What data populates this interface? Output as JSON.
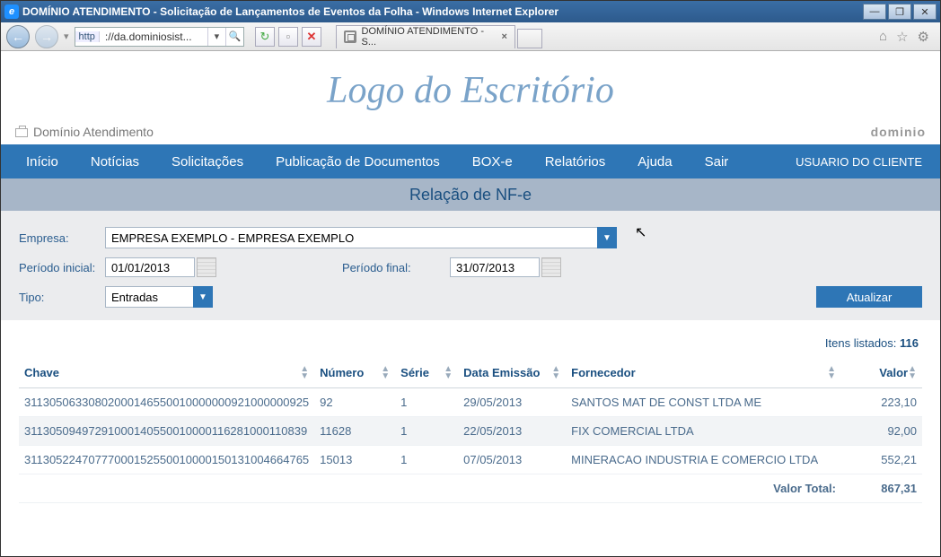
{
  "window": {
    "title": "DOMÍNIO ATENDIMENTO - Solicitação de Lançamentos de Eventos da Folha - Windows Internet Explorer"
  },
  "address": {
    "protocol": "http",
    "url_display": "://da.dominiosist..."
  },
  "tab": {
    "label": "DOMÍNIO ATENDIMENTO - S..."
  },
  "header": {
    "logo_text": "Logo do Escritório",
    "system_name": "Domínio Atendimento",
    "brand": "dominio"
  },
  "nav": {
    "items": [
      "Início",
      "Notícias",
      "Solicitações",
      "Publicação de Documentos",
      "BOX-e",
      "Relatórios",
      "Ajuda",
      "Sair"
    ],
    "user": "USUARIO DO CLIENTE"
  },
  "subtitle": "Relação de NF-e",
  "filters": {
    "empresa_label": "Empresa:",
    "empresa_value": "EMPRESA EXEMPLO - EMPRESA EXEMPLO",
    "periodo_inicial_label": "Período inicial:",
    "periodo_inicial_value": "01/01/2013",
    "periodo_final_label": "Período final:",
    "periodo_final_value": "31/07/2013",
    "tipo_label": "Tipo:",
    "tipo_value": "Entradas",
    "update_label": "Atualizar"
  },
  "listed": {
    "text": "Itens listados: ",
    "count": "116"
  },
  "columns": {
    "chave": "Chave",
    "numero": "Número",
    "serie": "Série",
    "data": "Data Emissão",
    "fornecedor": "Fornecedor",
    "valor": "Valor"
  },
  "rows": [
    {
      "chave": "31130506330802000146550010000000921000000925",
      "numero": "92",
      "serie": "1",
      "data": "29/05/2013",
      "fornecedor": "SANTOS MAT DE CONST LTDA ME",
      "valor": "223,10"
    },
    {
      "chave": "31130509497291000140550010000116281000110839",
      "numero": "11628",
      "serie": "1",
      "data": "22/05/2013",
      "fornecedor": "FIX COMERCIAL LTDA",
      "valor": "92,00"
    },
    {
      "chave": "31130522470777000152550010000150131004664765",
      "numero": "15013",
      "serie": "1",
      "data": "07/05/2013",
      "fornecedor": "MINERACAO INDUSTRIA E COMERCIO LTDA",
      "valor": "552,21"
    }
  ],
  "total": {
    "label": "Valor Total:",
    "value": "867,31"
  }
}
